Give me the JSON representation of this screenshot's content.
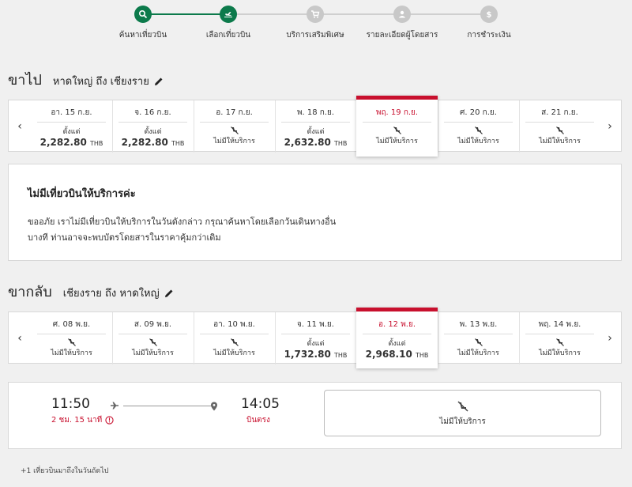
{
  "stepper": {
    "steps": [
      {
        "label": "ค้นหาเที่ยวบิน",
        "state": "done",
        "icon": "search-icon"
      },
      {
        "label": "เลือกเที่ยวบิน",
        "state": "current",
        "icon": "plane-icon"
      },
      {
        "label": "บริการเสริมพิเศษ",
        "state": "pending",
        "icon": "cart-icon"
      },
      {
        "label": "รายละเอียดผู้โดยสาร",
        "state": "pending",
        "icon": "person-icon"
      },
      {
        "label": "การชำระเงิน",
        "state": "pending",
        "icon": "dollar-icon"
      }
    ]
  },
  "outbound": {
    "title": "ขาไป",
    "route": "หาดใหญ่ ถึง เชียงราย",
    "dates": [
      {
        "date": "อา. 15 ก.ย.",
        "from": "ตั้งแต่",
        "price": "2,282.80",
        "currency": "THB"
      },
      {
        "date": "จ. 16 ก.ย.",
        "from": "ตั้งแต่",
        "price": "2,282.80",
        "currency": "THB"
      },
      {
        "date": "อ. 17 ก.ย.",
        "no_service": "ไม่มีให้บริการ"
      },
      {
        "date": "พ. 18 ก.ย.",
        "from": "ตั้งแต่",
        "price": "2,632.80",
        "currency": "THB"
      },
      {
        "date": "พฤ. 19 ก.ย.",
        "no_service": "ไม่มีให้บริการ",
        "selected": true
      },
      {
        "date": "ศ. 20 ก.ย.",
        "no_service": "ไม่มีให้บริการ"
      },
      {
        "date": "ส. 21 ก.ย.",
        "no_service": "ไม่มีให้บริการ"
      }
    ]
  },
  "no_flight": {
    "title": "ไม่มีเที่ยวบินให้บริการค่ะ",
    "line1": "ขออภัย เราไม่มีเที่ยวบินให้บริการในวันดังกล่าว กรุณาค้นหาโดยเลือกวันเดินทางอื่น",
    "line2": "บางที ท่านอาจจะพบบัตรโดยสารในราคาคุ้มกว่าเดิม"
  },
  "return": {
    "title": "ขากลับ",
    "route": "เชียงราย ถึง หาดใหญ่",
    "dates": [
      {
        "date": "ศ. 08 พ.ย.",
        "no_service": "ไม่มีให้บริการ"
      },
      {
        "date": "ส. 09 พ.ย.",
        "no_service": "ไม่มีให้บริการ"
      },
      {
        "date": "อา. 10 พ.ย.",
        "no_service": "ไม่มีให้บริการ"
      },
      {
        "date": "จ. 11 พ.ย.",
        "from": "ตั้งแต่",
        "price": "1,732.80",
        "currency": "THB"
      },
      {
        "date": "อ. 12 พ.ย.",
        "from": "ตั้งแต่",
        "price": "2,968.10",
        "currency": "THB",
        "selected": true
      },
      {
        "date": "พ. 13 พ.ย.",
        "no_service": "ไม่มีให้บริการ"
      },
      {
        "date": "พฤ. 14 พ.ย.",
        "no_service": "ไม่มีให้บริการ"
      }
    ]
  },
  "flight": {
    "departure": "11:50",
    "arrival": "14:05",
    "duration": "2 ชม. 15 นาที",
    "type": "บินตรง",
    "fare_status": "ไม่มีให้บริการ"
  },
  "footnote": "+1 เที่ยวบินมาถึงในวันถัดไป",
  "colors": {
    "accent_green": "#0c7a4b",
    "accent_red": "#c8102e"
  }
}
